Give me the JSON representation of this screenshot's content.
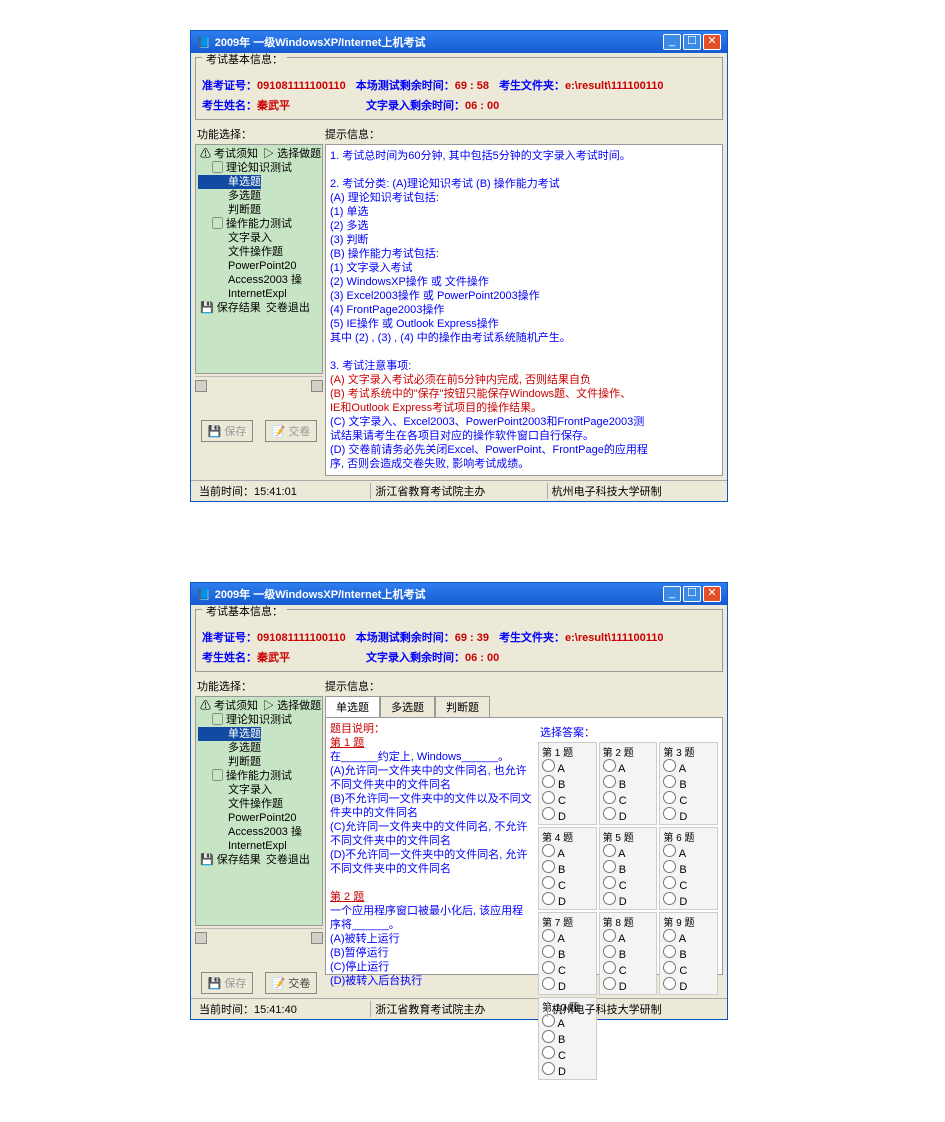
{
  "w1": {
    "title": "2009年 一级WindowsXP/Internet上机考试",
    "info": {
      "l_zh": "准考证号：",
      "zh": "091081111100110",
      "l_sj": "本场测试剩余时间：",
      "sj": "69 : 58",
      "l_wj": "考生文件夹：",
      "wj": "e:\\result\\111100110",
      "l_xm": "考生姓名：",
      "xm": "秦武平",
      "l_wz": "文字录入剩余时间：",
      "wz": "06 : 00"
    },
    "tree": {
      "t0": "⚠ 考试须知",
      "t1": "▷ 选择做题",
      "t2": "▢ 理论知识测试",
      "t3": "单选题",
      "t4": "多选题",
      "t5": "判断题",
      "t6": "▢ 操作能力测试",
      "t7": "文字录入",
      "t8": "文件操作题",
      "t9": "PowerPoint20",
      "t10": "Access2003 操",
      "t11": "InternetExpl",
      "t12": "💾 保存结果",
      "t13": "交卷退出"
    },
    "btns": {
      "save": "💾 保存",
      "submit": "📝 交卷"
    },
    "rhead": "提示信息：",
    "body": {
      "l1": "1. 考试总时间为60分钟, 其中包括5分钟的文字录入考试时间。",
      "l2": "2. 考试分类:  (A)理论知识考试  (B) 操作能力考试",
      "l3": "   (A) 理论知识考试包括:",
      "l4": "      (1) 单选",
      "l5": "      (2) 多选",
      "l6": "      (3) 判断",
      "l7": "   (B) 操作能力考试包括:",
      "l8": "      (1) 文字录入考试",
      "l9": "      (2) WindowsXP操作 或 文件操作",
      "l10": "      (3) Excel2003操作 或 PowerPoint2003操作",
      "l11": "      (4) FrontPage2003操作",
      "l12": "      (5) IE操作 或 Outlook Express操作",
      "l13": "      其中 (2) , (3) , (4) 中的操作由考试系统随机产生。",
      "l14": "3. 考试注意事项:",
      "l15": "   (A) 文字录入考试必须在前5分钟内完成, 否则结果自负",
      "l16": "   (B) 考试系统中的\"保存\"按钮只能保存Windows题、文件操作、",
      "l17": "       IE和Outlook Express考试项目的操作结果。",
      "l18": "   (C) 文字录入、Excel2003、PowerPoint2003和FrontPage2003测",
      "l19": "       试结果请考生在各项目对应的操作软件窗口自行保存。",
      "l20": "   (D) 交卷前请务必先关闭Excel、PowerPoint、FrontPage的应用程",
      "l21": "       序, 否则会造成交卷失败, 影响考试成绩。"
    },
    "status": {
      "s0": "当前时间：15:41:01",
      "s1": "浙江省教育考试院主办",
      "s2": "杭州电子科技大学研制"
    }
  },
  "w2": {
    "title": "2009年 一级WindowsXP/Internet上机考试",
    "info": {
      "l_zh": "准考证号：",
      "zh": "091081111100110",
      "l_sj": "本场测试剩余时间：",
      "sj": "69 : 39",
      "l_wj": "考生文件夹：",
      "wj": "e:\\result\\111100110",
      "l_xm": "考生姓名：",
      "xm": "秦武平",
      "l_wz": "文字录入剩余时间：",
      "wz": "06 : 00"
    },
    "tree": {
      "t0": "⚠ 考试须知",
      "t1": "▷ 选择做题",
      "t2": "▢ 理论知识测试",
      "t3": "单选题",
      "t4": "多选题",
      "t5": "判断题",
      "t6": "▢ 操作能力测试",
      "t7": "文字录入",
      "t8": "文件操作题",
      "t9": "PowerPoint20",
      "t10": "Access2003 操",
      "t11": "InternetExpl",
      "t12": "💾 保存结果",
      "t13": "交卷退出"
    },
    "btns": {
      "save": "💾 保存",
      "submit": "📝 交卷"
    },
    "rhead": "提示信息：",
    "tabs": {
      "t0": "单选题",
      "t1": "多选题",
      "t2": "判断题"
    },
    "q": {
      "head": "题目说明：",
      "q1": "第 1 题",
      "q1a": "在______约定上, Windows______。",
      "q1b": "(A)允许同一文件夹中的文件同名, 也允许不同文件夹中的文件同名",
      "q1c": "(B)不允许同一文件夹中的文件以及不同文件夹中的文件同名",
      "q1d": "(C)允许同一文件夹中的文件同名, 不允许不同文件夹中的文件同名",
      "q1e": "(D)不允许同一文件夹中的文件同名, 允许不同文件夹中的文件同名",
      "q2": "第 2 题",
      "q2a": "一个应用程序窗口被最小化后, 该应用程序将______。",
      "q2b": "(A)被转上运行",
      "q2c": "(B)暂停运行",
      "q2d": "(C)停止运行",
      "q2e": "(D)被转入后台执行"
    },
    "ans": {
      "head": "选择答案：",
      "cells": [
        "第 1 题",
        "第 2 题",
        "第 3 题",
        "第 4 题",
        "第 5 题",
        "第 6 题",
        "第 7 题",
        "第 8 题",
        "第 9 题",
        "第 10 题"
      ],
      "opts": [
        "A",
        "B",
        "C",
        "D"
      ]
    },
    "status": {
      "s0": "当前时间：15:41:40",
      "s1": "浙江省教育考试院主办",
      "s2": "杭州电子科技大学研制"
    }
  }
}
